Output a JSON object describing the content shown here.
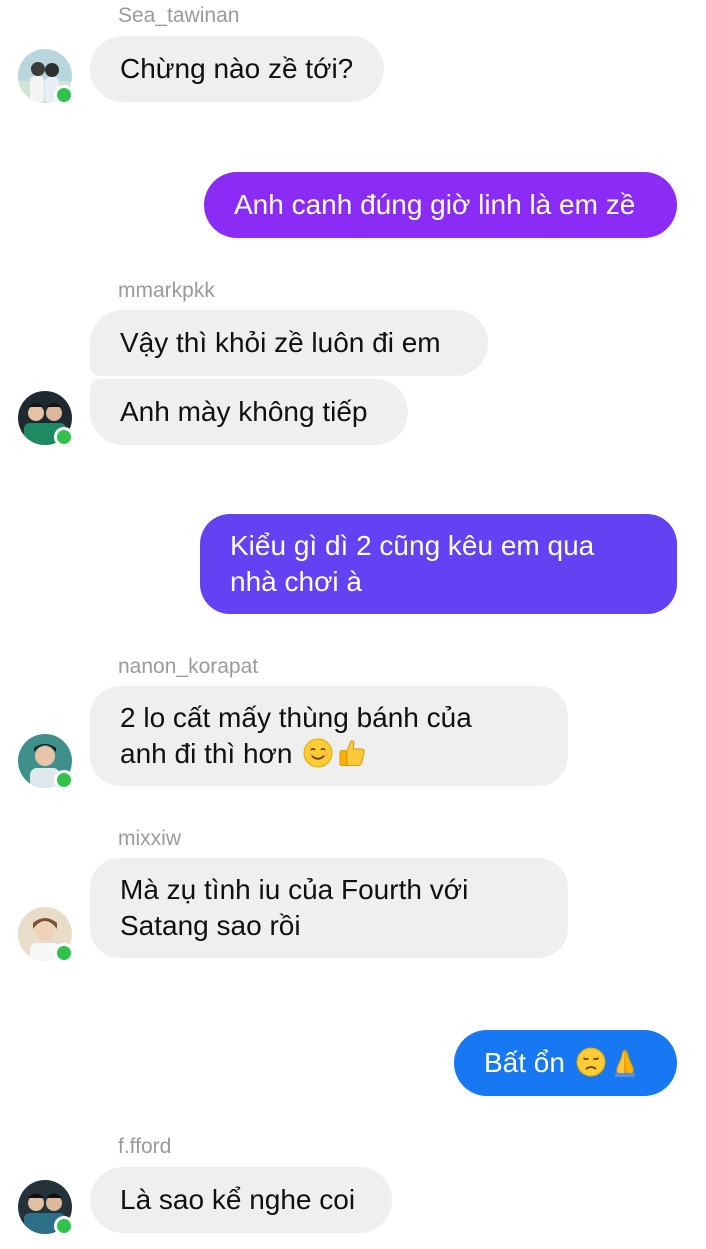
{
  "conversation": {
    "messages": [
      {
        "sender": "Sea_tawinan",
        "text": "Chừng nào zề tới?"
      },
      {
        "sender": "",
        "text": "Anh canh đúng giờ linh là em zề",
        "outgoing": true
      },
      {
        "sender": "mmarkpkk",
        "text": "Vậy thì khỏi zề luôn đi em"
      },
      {
        "sender": "",
        "text": "Anh mày không tiếp"
      },
      {
        "sender": "",
        "text": "Kiểu gì dì 2 cũng kêu em qua\nnhà chơi à",
        "outgoing": true
      },
      {
        "sender": "nanon_korapat",
        "text": "2 lo cất mấy thùng bánh của\nanh đi thì hơn"
      },
      {
        "sender": "mixxiw",
        "text": "Mà zụ tình iu của Fourth với\nSatang sao rồi"
      },
      {
        "sender": "",
        "text": "Bất ổn",
        "outgoing": true
      },
      {
        "sender": "f.fford",
        "text": "Là sao kể nghe coi"
      }
    ],
    "emojis": {
      "m5": [
        "smiling-face-icon",
        "thumbs-up-icon"
      ],
      "m7": [
        "disappointed-face-icon",
        "folded-hands-icon"
      ]
    },
    "colors": {
      "incoming_bubble": "#efefef",
      "outgoing_purple": "#8a2cf5",
      "outgoing_indigo": "#6242f2",
      "outgoing_blue": "#1877f2",
      "online_dot": "#31c24d"
    }
  }
}
